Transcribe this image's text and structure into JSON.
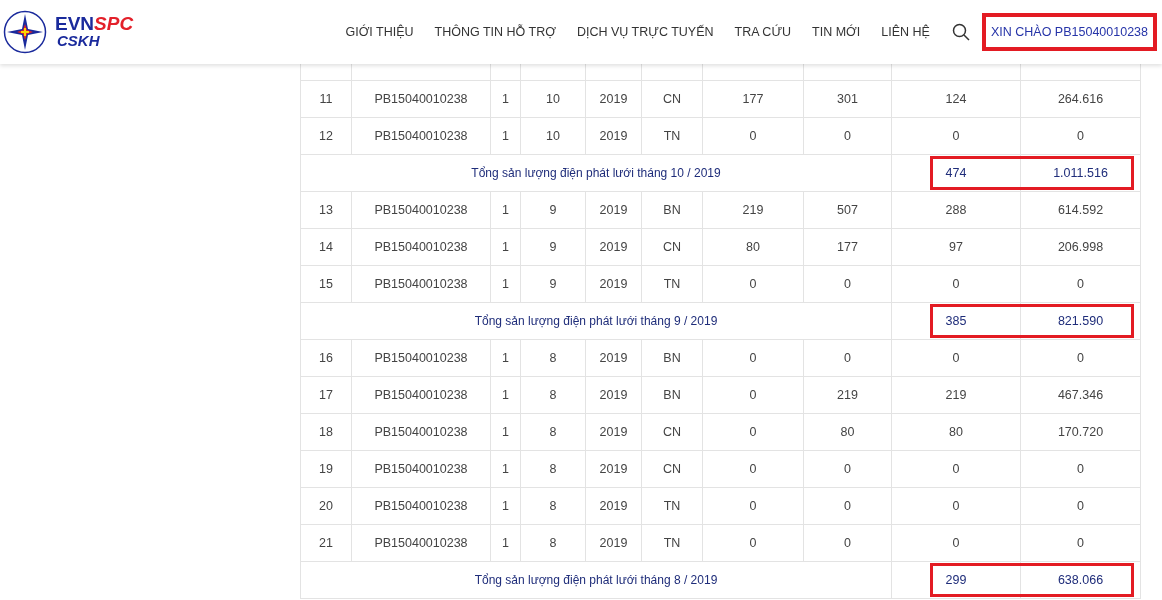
{
  "header": {
    "logo": {
      "brand_left": "EVN",
      "brand_right": "SPC",
      "subtitle": "CSKH"
    },
    "nav": [
      "GIỚI THIỆU",
      "THÔNG TIN HỖ TRỢ",
      "DỊCH VỤ TRỰC TUYẾN",
      "TRA CỨU",
      "TIN MỚI",
      "LIÊN HỆ"
    ],
    "greeting": {
      "text": "XIN CHÀO PB15040010238",
      "highlighted": true
    }
  },
  "table": {
    "rows": [
      {
        "kind": "data",
        "cells": [
          "11",
          "PB15040010238",
          "1",
          "10",
          "2019",
          "CN",
          "177",
          "301",
          "124",
          "264.616"
        ]
      },
      {
        "kind": "data",
        "cells": [
          "12",
          "PB15040010238",
          "1",
          "10",
          "2019",
          "TN",
          "0",
          "0",
          "0",
          "0"
        ]
      },
      {
        "kind": "total",
        "label": "Tổng sản lượng điện phát lưới tháng 10 / 2019",
        "cells": [
          "474",
          "1.011.516"
        ],
        "highlighted": true
      },
      {
        "kind": "data",
        "cells": [
          "13",
          "PB15040010238",
          "1",
          "9",
          "2019",
          "BN",
          "219",
          "507",
          "288",
          "614.592"
        ]
      },
      {
        "kind": "data",
        "cells": [
          "14",
          "PB15040010238",
          "1",
          "9",
          "2019",
          "CN",
          "80",
          "177",
          "97",
          "206.998"
        ]
      },
      {
        "kind": "data",
        "cells": [
          "15",
          "PB15040010238",
          "1",
          "9",
          "2019",
          "TN",
          "0",
          "0",
          "0",
          "0"
        ]
      },
      {
        "kind": "total",
        "label": "Tổng sản lượng điện phát lưới tháng 9 / 2019",
        "cells": [
          "385",
          "821.590"
        ],
        "highlighted": true
      },
      {
        "kind": "data",
        "cells": [
          "16",
          "PB15040010238",
          "1",
          "8",
          "2019",
          "BN",
          "0",
          "0",
          "0",
          "0"
        ]
      },
      {
        "kind": "data",
        "cells": [
          "17",
          "PB15040010238",
          "1",
          "8",
          "2019",
          "BN",
          "0",
          "219",
          "219",
          "467.346"
        ]
      },
      {
        "kind": "data",
        "cells": [
          "18",
          "PB15040010238",
          "1",
          "8",
          "2019",
          "CN",
          "0",
          "80",
          "80",
          "170.720"
        ]
      },
      {
        "kind": "data",
        "cells": [
          "19",
          "PB15040010238",
          "1",
          "8",
          "2019",
          "CN",
          "0",
          "0",
          "0",
          "0"
        ]
      },
      {
        "kind": "data",
        "cells": [
          "20",
          "PB15040010238",
          "1",
          "8",
          "2019",
          "TN",
          "0",
          "0",
          "0",
          "0"
        ]
      },
      {
        "kind": "data",
        "cells": [
          "21",
          "PB15040010238",
          "1",
          "8",
          "2019",
          "TN",
          "0",
          "0",
          "0",
          "0"
        ]
      },
      {
        "kind": "total",
        "label": "Tổng sản lượng điện phát lưới tháng 8 / 2019",
        "cells": [
          "299",
          "638.066"
        ],
        "highlighted": true
      }
    ]
  }
}
